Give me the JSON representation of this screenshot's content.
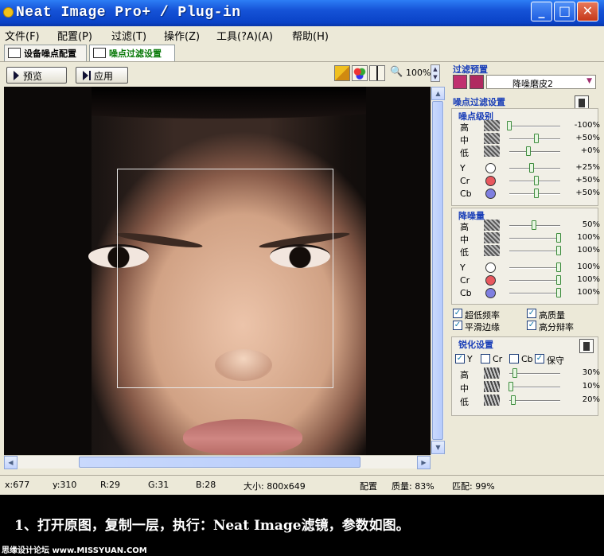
{
  "window": {
    "title": "Neat Image Pro+ / Plug-in"
  },
  "menu": [
    "文件(F)",
    "配置(P)",
    "过滤(T)",
    "操作(Z)",
    "工具(?A)(A)",
    "帮助(H)"
  ],
  "tabs": [
    "设备噪点配置",
    "噪点过滤设置"
  ],
  "toolbar": {
    "preview": "预览",
    "apply": "应用",
    "zoom": "100%"
  },
  "filter_preset": {
    "title": "过滤预置",
    "value": "降噪磨皮2"
  },
  "noise_filter": {
    "title": "噪点过滤设置",
    "level_title": "噪点级别",
    "levels": [
      {
        "label": "高",
        "value": "-100%",
        "pos": 0.0
      },
      {
        "label": "中",
        "value": "+50%",
        "pos": 0.55
      },
      {
        "label": "低",
        "value": "+0%",
        "pos": 0.38
      },
      {
        "label": "Y",
        "value": "+25%",
        "pos": 0.45,
        "color": "#ffffff"
      },
      {
        "label": "Cr",
        "value": "+50%",
        "pos": 0.55,
        "color": "#e8585e"
      },
      {
        "label": "Cb",
        "value": "+50%",
        "pos": 0.55,
        "color": "#7f7fe0"
      }
    ],
    "reduction_title": "降噪量",
    "reductions": [
      {
        "label": "高",
        "value": "50%",
        "pos": 0.5
      },
      {
        "label": "中",
        "value": "100%",
        "pos": 1.0
      },
      {
        "label": "低",
        "value": "100%",
        "pos": 1.0
      },
      {
        "label": "Y",
        "value": "100%",
        "pos": 1.0,
        "color": "#ffffff"
      },
      {
        "label": "Cr",
        "value": "100%",
        "pos": 1.0,
        "color": "#e8585e"
      },
      {
        "label": "Cb",
        "value": "100%",
        "pos": 1.0,
        "color": "#7f7fe0"
      }
    ],
    "options": [
      "超低频率",
      "高质量",
      "平滑边缘",
      "高分辩率"
    ]
  },
  "sharpen": {
    "title": "锐化设置",
    "channels": [
      {
        "label": "Y",
        "checked": true
      },
      {
        "label": "Cr",
        "checked": false
      },
      {
        "label": "Cb",
        "checked": false
      },
      {
        "label": "保守",
        "checked": true
      }
    ],
    "levels": [
      {
        "label": "高",
        "value": "30%",
        "pos": 0.12
      },
      {
        "label": "中",
        "value": "10%",
        "pos": 0.04
      },
      {
        "label": "低",
        "value": "20%",
        "pos": 0.08
      }
    ]
  },
  "status": {
    "x": "x:677",
    "y": "y:310",
    "r": "R:29",
    "g": "G:31",
    "b": "B:28",
    "size": "大小: 800x649",
    "profile": "配置",
    "quality": "质量: 83%",
    "match": "匹配: 99%"
  },
  "caption": "1、打开原图，复制一层，执行：Neat Image滤镜，参数如图。",
  "footer": "思缘设计论坛 www.MISSYUAN.COM"
}
